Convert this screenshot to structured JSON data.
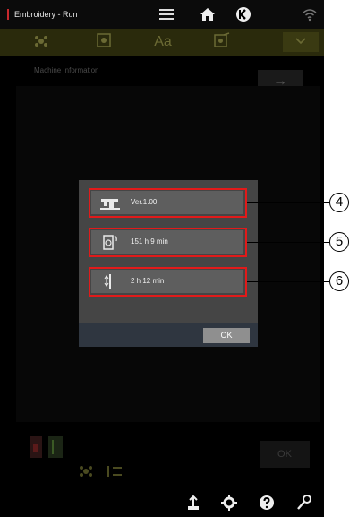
{
  "header": {
    "app_title": "Embroidery - Run"
  },
  "tabs": {
    "text_tab": "Aa"
  },
  "background": {
    "panel_title": "Machine Information",
    "arrow": "→",
    "ok_label": "OK"
  },
  "dialog": {
    "rows": [
      {
        "icon": "sewing-machine-icon",
        "value": "Ver.1.00"
      },
      {
        "icon": "machine-time-icon",
        "value": "151 h 9 min"
      },
      {
        "icon": "needle-icon",
        "value": "2 h 12 min"
      }
    ],
    "ok_label": "OK"
  },
  "callouts": [
    "4",
    "5",
    "6"
  ],
  "colors": {
    "highlight": "#e11a1a",
    "title_accent": "#c8282d",
    "tab_bar": "#2a2a0c"
  }
}
